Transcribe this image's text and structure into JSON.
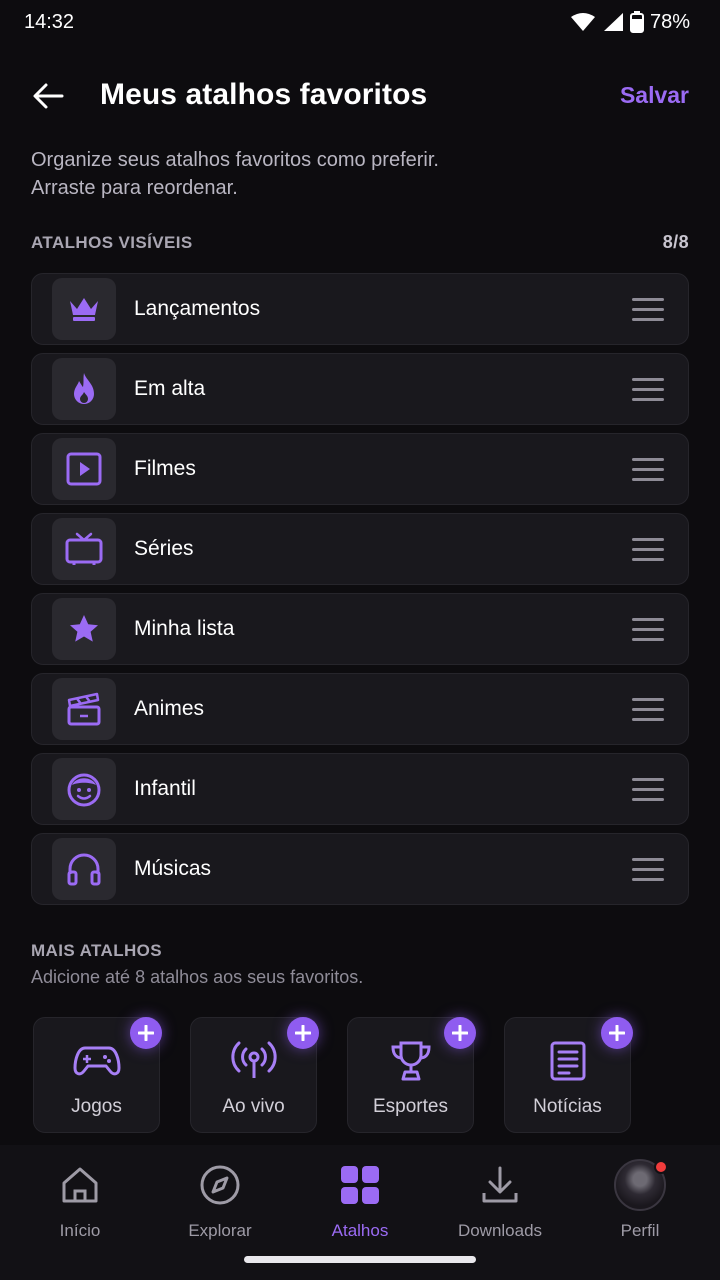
{
  "status_bar": {
    "time": "14:32",
    "battery": "78%"
  },
  "header": {
    "title": "Meus atalhos favoritos",
    "save_label": "Salvar"
  },
  "intro": {
    "line1": "Organize seus atalhos favoritos como preferir.",
    "line2": "Arraste para reordenar."
  },
  "visible_section": {
    "title": "ATALHOS VISÍVEIS",
    "count": "8/8",
    "items": [
      {
        "label": "Lançamentos",
        "icon": "crown-icon"
      },
      {
        "label": "Em alta",
        "icon": "fire-icon"
      },
      {
        "label": "Filmes",
        "icon": "play-icon"
      },
      {
        "label": "Séries",
        "icon": "tv-icon"
      },
      {
        "label": "Minha lista",
        "icon": "star-icon"
      },
      {
        "label": "Animes",
        "icon": "clapperboard-icon"
      },
      {
        "label": "Infantil",
        "icon": "kid-face-icon"
      },
      {
        "label": "Músicas",
        "icon": "headphones-icon"
      }
    ]
  },
  "more_section": {
    "title": "MAIS ATALHOS",
    "subtitle": "Adicione até 8 atalhos aos seus favoritos.",
    "items": [
      {
        "label": "Jogos",
        "icon": "gamepad-icon"
      },
      {
        "label": "Ao vivo",
        "icon": "broadcast-icon"
      },
      {
        "label": "Esportes",
        "icon": "trophy-icon"
      },
      {
        "label": "Notícias",
        "icon": "news-icon"
      }
    ]
  },
  "bottom_nav": {
    "items": [
      {
        "label": "Início",
        "icon": "home-icon"
      },
      {
        "label": "Explorar",
        "icon": "compass-icon"
      },
      {
        "label": "Atalhos",
        "icon": "grid-icon",
        "active": true
      },
      {
        "label": "Downloads",
        "icon": "download-icon"
      },
      {
        "label": "Perfil",
        "icon": "avatar"
      }
    ]
  },
  "colors": {
    "accent": "#9b6bf4",
    "background": "#0d0c0f",
    "card": "#19181d",
    "notification": "#f03c3c"
  }
}
